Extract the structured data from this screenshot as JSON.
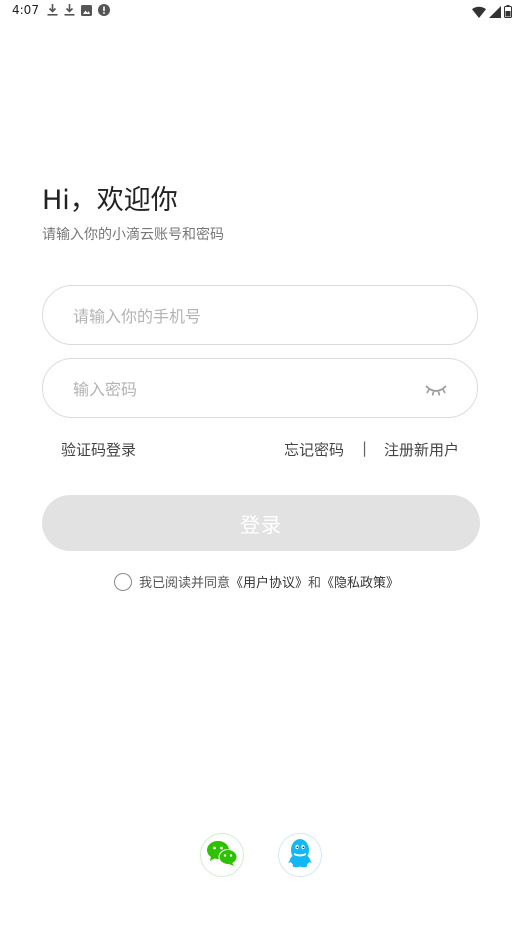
{
  "status_bar": {
    "time": "4:07",
    "left_icons": [
      "download-icon",
      "download-icon",
      "image-icon",
      "alert-icon"
    ],
    "right_icons": [
      "wifi-icon",
      "signal-icon",
      "battery-icon"
    ]
  },
  "header": {
    "greeting": "Hi，欢迎你",
    "subtitle": "请输入你的小滴云账号和密码"
  },
  "form": {
    "phone_placeholder": "请输入你的手机号",
    "phone_value": "",
    "password_placeholder": "输入密码",
    "password_value": "",
    "password_toggle_icon": "eye-closed-icon"
  },
  "links": {
    "sms_login": "验证码登录",
    "forgot_password": "忘记密码",
    "divider": "|",
    "register": "注册新用户"
  },
  "login_button": {
    "label": "登录",
    "color": "#e2e2e2"
  },
  "agreement": {
    "prefix": "我已阅读并同意",
    "user_agreement": "《用户协议》",
    "conjunction": "和",
    "privacy_policy": "《隐私政策》",
    "checked": false
  },
  "social_login": [
    {
      "icon": "wechat-icon",
      "color": "#2dc100"
    },
    {
      "icon": "qq-icon",
      "color": "#12b7f5"
    }
  ]
}
